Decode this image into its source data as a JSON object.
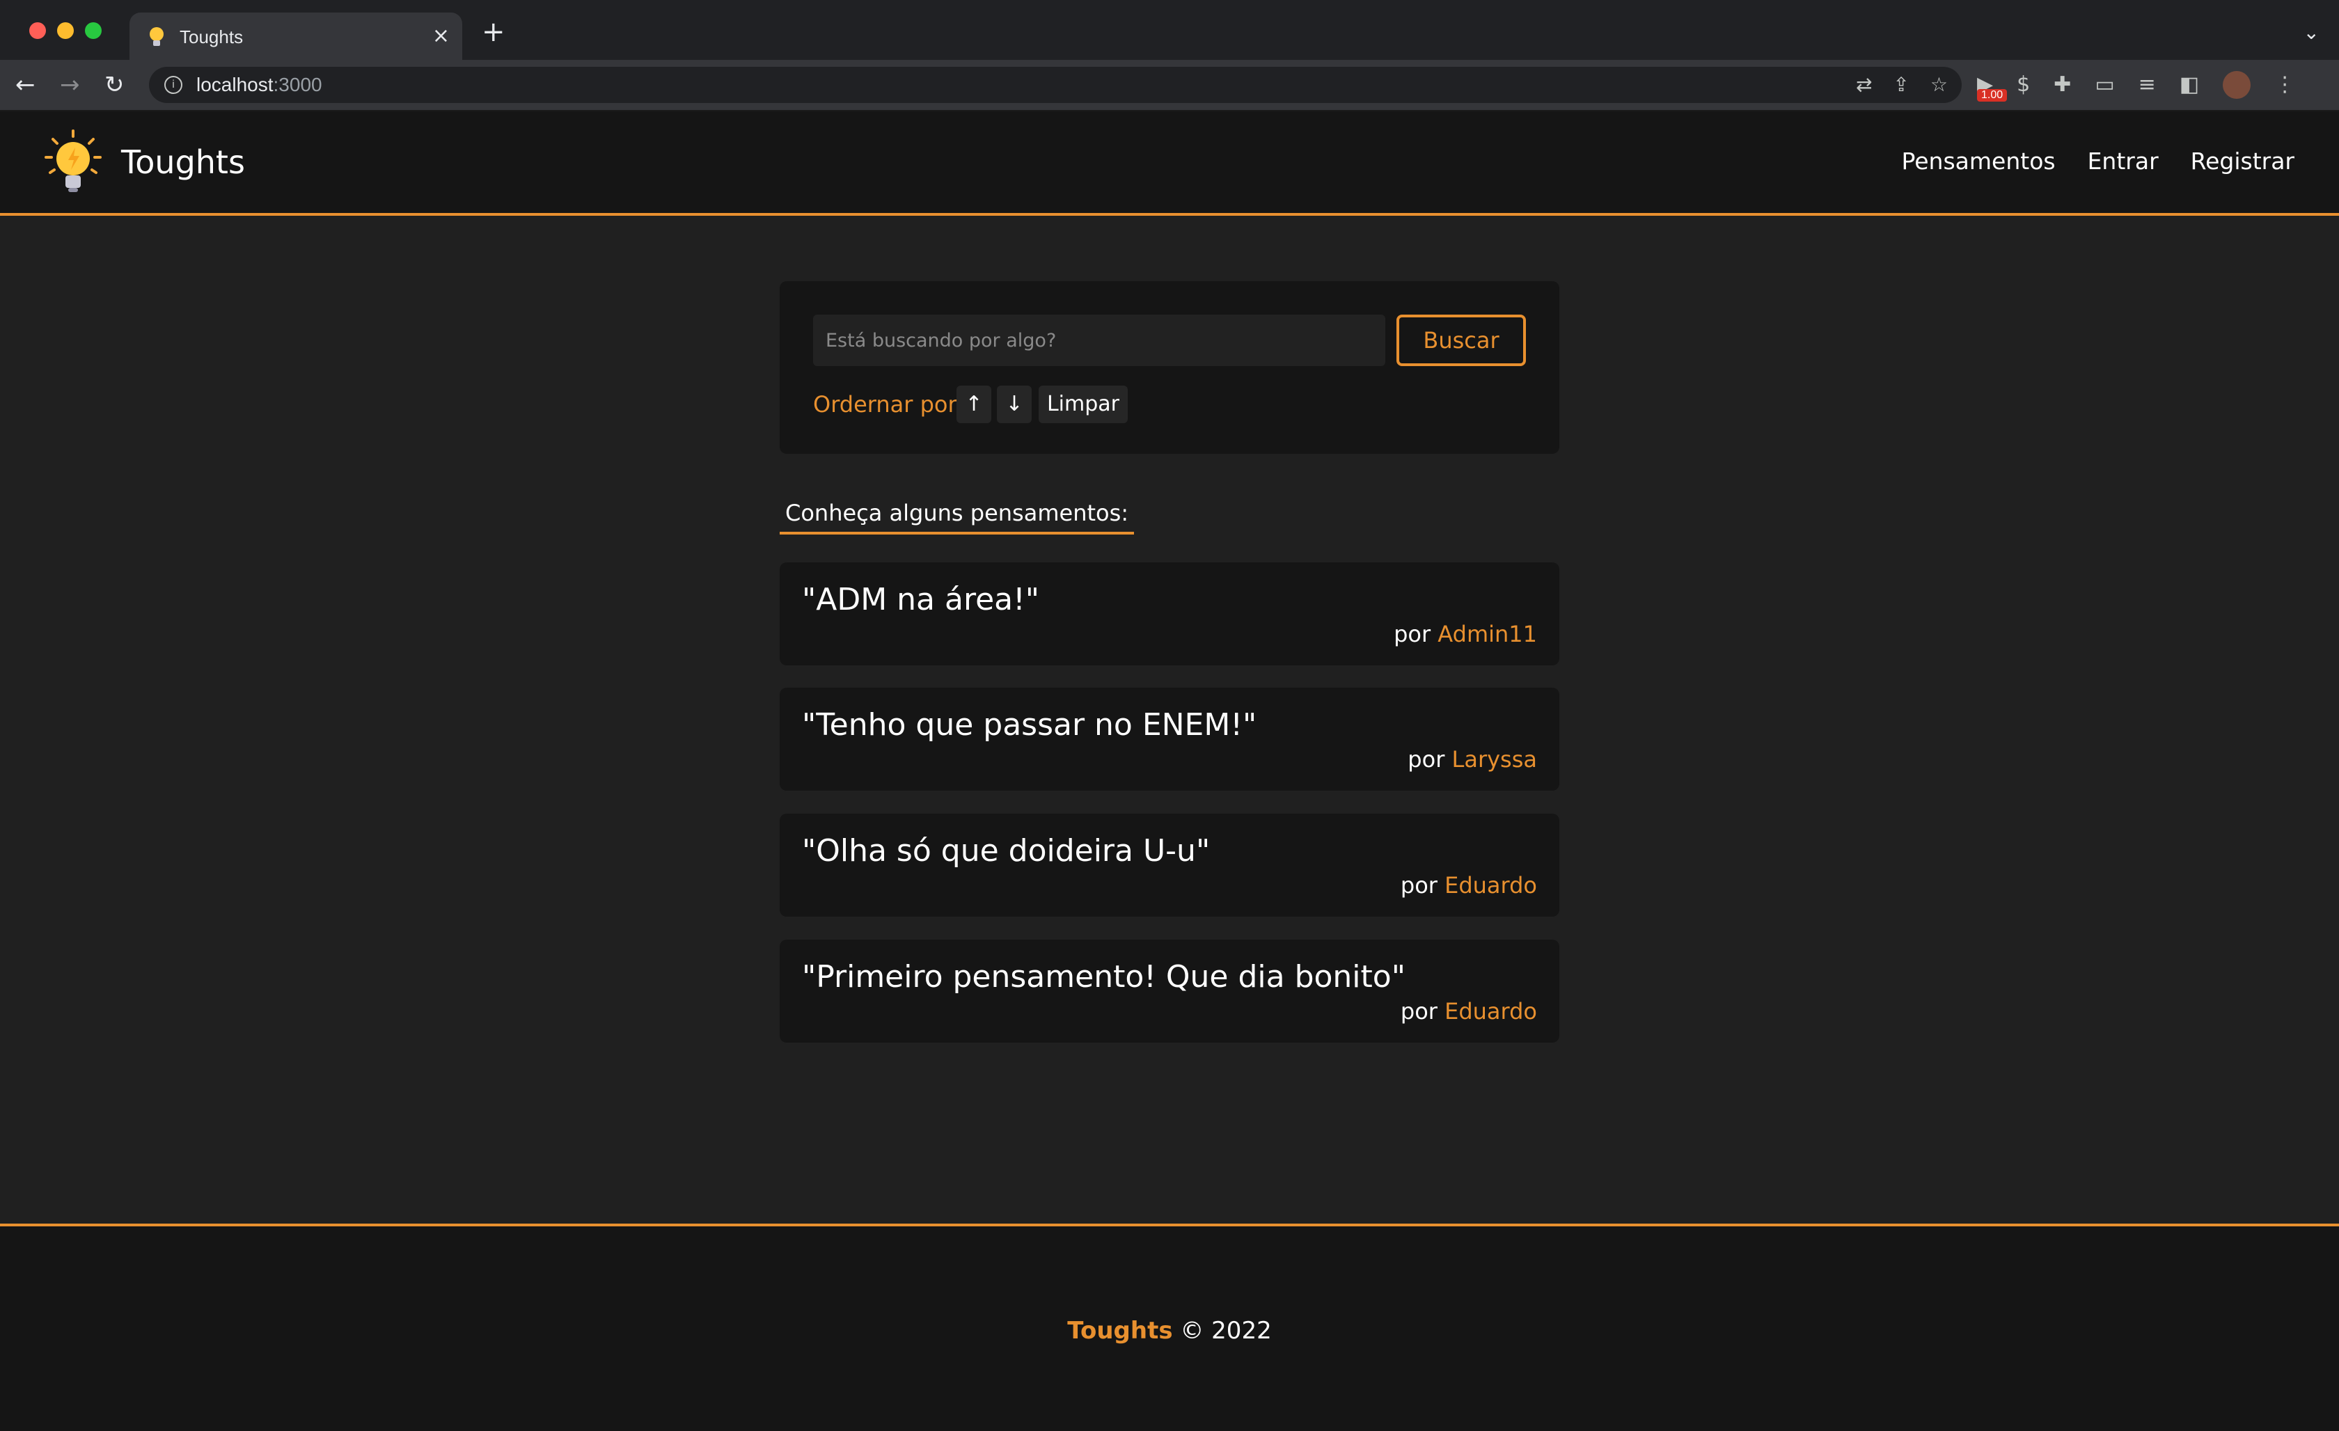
{
  "browser": {
    "tab_title": "Toughts",
    "url_host": "localhost",
    "url_port": ":3000",
    "extension_badge": "1.00"
  },
  "navbar": {
    "brand": "Toughts",
    "links": [
      "Pensamentos",
      "Entrar",
      "Registrar"
    ]
  },
  "search": {
    "placeholder": "Está buscando por algo?",
    "button_label": "Buscar",
    "order_label": "Ordernar por:",
    "order_asc": "↑",
    "order_desc": "↓",
    "clear_label": "Limpar"
  },
  "section_title": "Conheça alguns pensamentos:",
  "thoughts": [
    {
      "text": "\"ADM na área!\"",
      "by": "por",
      "author": "Admin11"
    },
    {
      "text": "\"Tenho que passar no ENEM!\"",
      "by": "por",
      "author": "Laryssa"
    },
    {
      "text": "\"Olha só que doideira U-u\"",
      "by": "por",
      "author": "Eduardo"
    },
    {
      "text": "\"Primeiro pensamento! Que dia bonito\"",
      "by": "por",
      "author": "Eduardo"
    }
  ],
  "footer": {
    "brand": "Toughts",
    "copyright": " © 2022"
  },
  "colors": {
    "accent": "#e8902f",
    "background": "#202020",
    "card": "#151515"
  }
}
